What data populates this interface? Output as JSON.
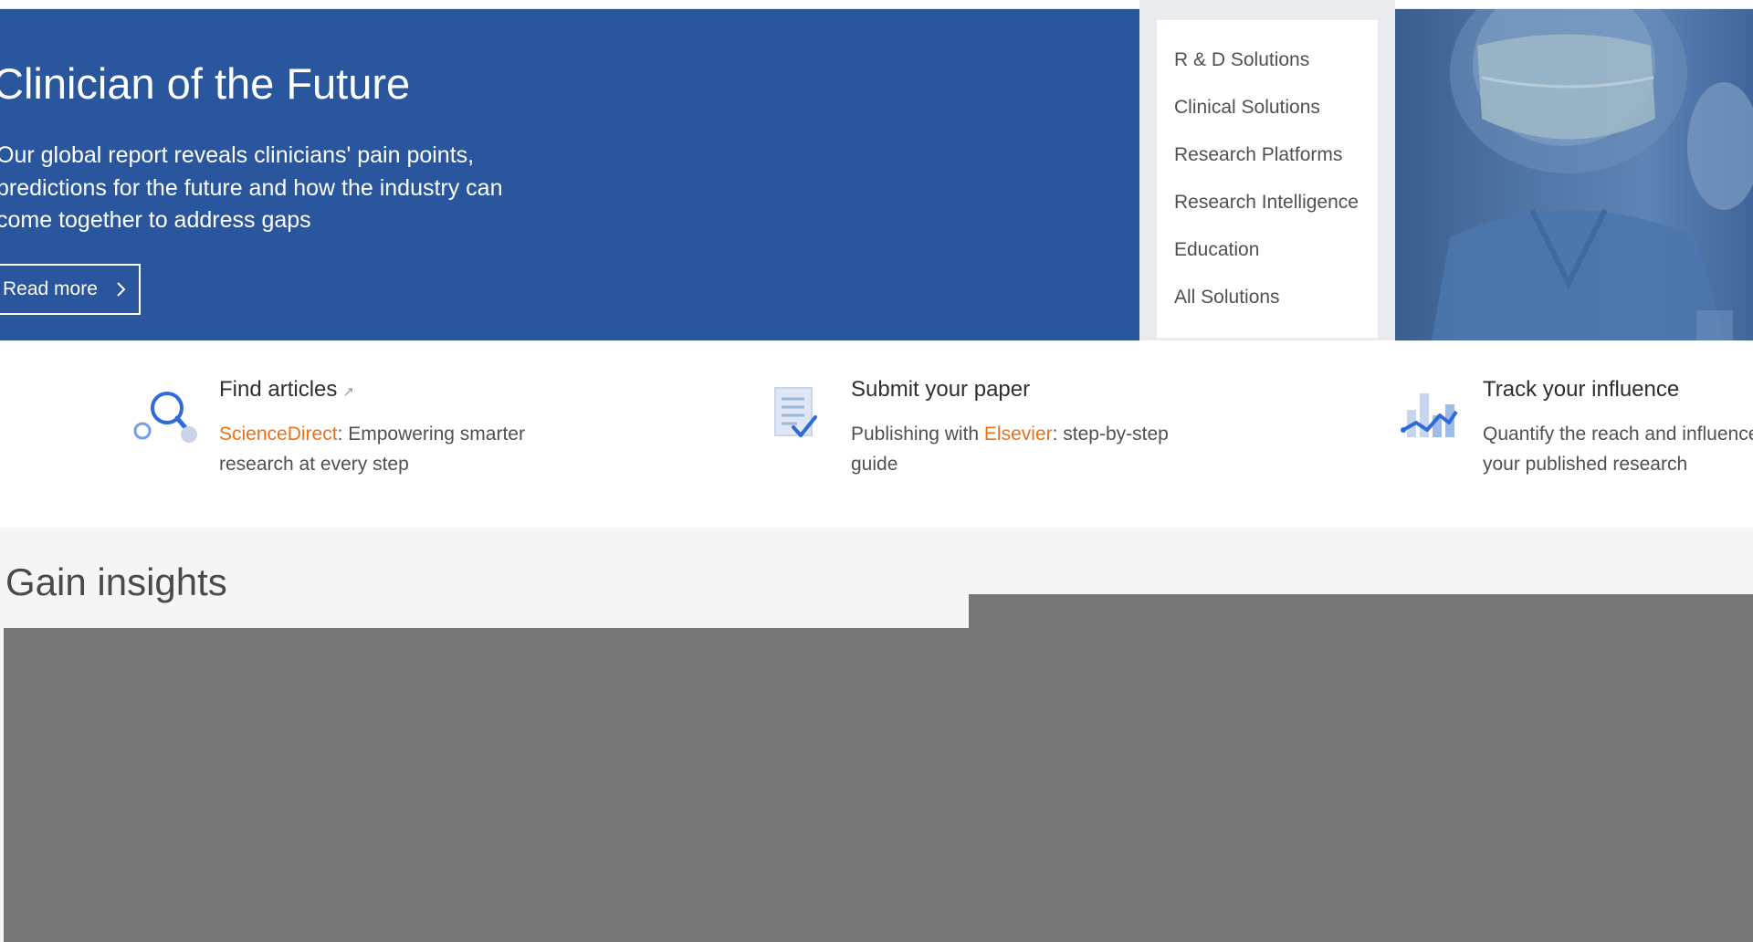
{
  "hero": {
    "title": "Clinician of the Future",
    "description": "Our global report reveals clinicians' pain points, predictions for the future and how the industry can come together to address gaps",
    "read_more_label": "Read more",
    "background_color": "#2a569e"
  },
  "solutions_menu": {
    "items": [
      {
        "label": "R & D Solutions"
      },
      {
        "label": "Clinical Solutions"
      },
      {
        "label": "Research Platforms"
      },
      {
        "label": "Research Intelligence"
      },
      {
        "label": "Education"
      },
      {
        "label": "All Solutions"
      }
    ]
  },
  "features": [
    {
      "title": "Find articles",
      "icon": "search-articles-icon",
      "link_text": "ScienceDirect",
      "description": ": Empowering smarter research at every step"
    },
    {
      "title": "Submit your paper",
      "icon": "document-check-icon",
      "prefix": "Publishing with ",
      "link_text": "Elsevier",
      "description": ": step-by-step guide"
    },
    {
      "title": "Track your influence",
      "icon": "chart-trend-icon",
      "description": "Quantify the reach and influence of your published research"
    }
  ],
  "insights": {
    "title": "Gain insights"
  },
  "colors": {
    "accent_orange": "#e9711c",
    "hero_blue": "#2a569e",
    "icon_blue": "#2f6bd6",
    "placeholder_gray": "#767676"
  }
}
